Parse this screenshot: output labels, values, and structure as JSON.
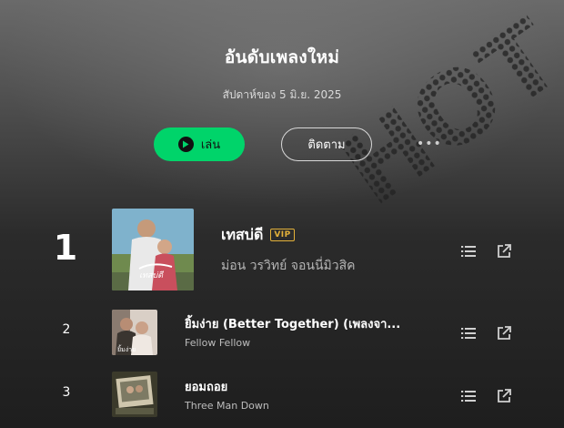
{
  "header": {
    "title": "อันดับเพลงใหม่",
    "subtitle": "สัปดาห์ของ 5 มิ.ย. 2025"
  },
  "actions": {
    "play_label": "เล่น",
    "follow_label": "ติดตาม"
  },
  "colors": {
    "accent": "#00d46a",
    "vip": "#e3b13a"
  },
  "tracks": [
    {
      "rank": "1",
      "title": "เทสบ่ดี",
      "badge": "VIP",
      "artist": "ม่อน วรวิทย์ จอนนี่มิวสิค"
    },
    {
      "rank": "2",
      "title": "ยิ้มง่าย (Better Together) (เพลงจา...",
      "artist": "Fellow Fellow"
    },
    {
      "rank": "3",
      "title": "ยอมถอย",
      "artist": "Three Man Down"
    }
  ],
  "icons": [
    "play-icon",
    "more-icon",
    "list-icon",
    "share-icon"
  ]
}
